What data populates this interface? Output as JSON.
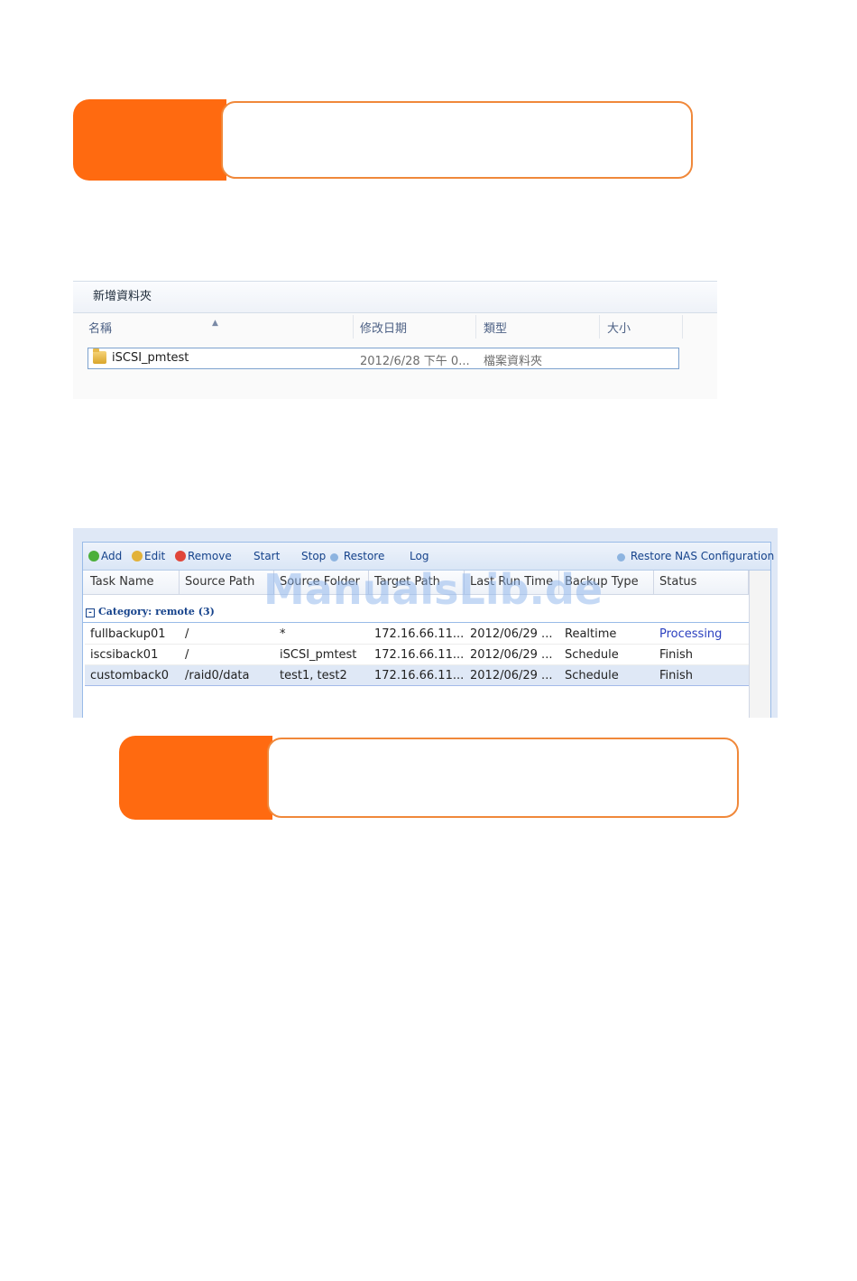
{
  "colors": {
    "accent_orange": "#ff6a10",
    "note_border": "#f0883a",
    "status_processing": "#2a3fbf"
  },
  "explorer": {
    "toolbar_label": "新增資料夾",
    "columns": [
      "名稱",
      "修改日期",
      "類型",
      "大小"
    ],
    "rows": [
      {
        "icon": "folder-icon",
        "name": "iSCSI_pmtest",
        "modified": "2012/6/28 下午 0...",
        "type": "檔案資料夾",
        "size": ""
      }
    ]
  },
  "backup": {
    "toolbar": {
      "add": "Add",
      "edit": "Edit",
      "remove": "Remove",
      "start": "Start",
      "stop": "Stop",
      "restore": "Restore",
      "log": "Log",
      "restore_nas": "Restore NAS Configuration"
    },
    "columns": [
      "Task Name",
      "Source Path",
      "Source Folder",
      "Target Path",
      "Last Run Time",
      "Backup Type",
      "Status"
    ],
    "category": "Category: remote (3)",
    "rows": [
      {
        "task": "fullbackup01",
        "source_path": "/",
        "source_folder": "*",
        "target_path": "172.16.66.11...",
        "last_run": "2012/06/29 ...",
        "backup_type": "Realtime",
        "status": "Processing"
      },
      {
        "task": "iscsiback01",
        "source_path": "/",
        "source_folder": "iSCSI_pmtest",
        "target_path": "172.16.66.11...",
        "last_run": "2012/06/29 ...",
        "backup_type": "Schedule",
        "status": "Finish"
      },
      {
        "task": "customback0",
        "source_path": "/raid0/data",
        "source_folder": "test1, test2",
        "target_path": "172.16.66.11...",
        "last_run": "2012/06/29 ...",
        "backup_type": "Schedule",
        "status": "Finish"
      }
    ]
  },
  "watermark": "ManualsLib.de"
}
